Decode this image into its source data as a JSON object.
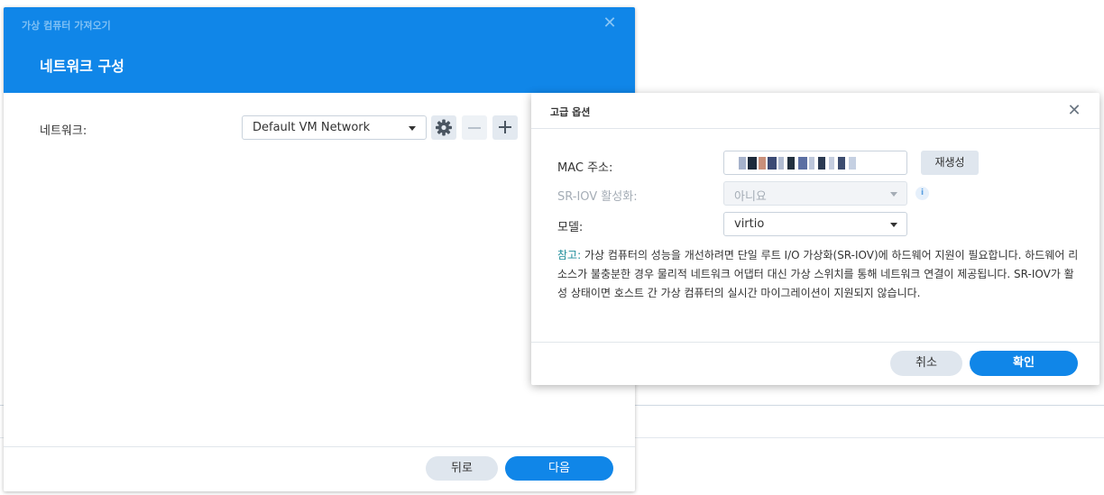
{
  "wizard": {
    "title": "가상 컴퓨터 가져오기",
    "step_title": "네트워크 구성",
    "network_label": "네트워크:",
    "network_value": "Default VM Network",
    "back_label": "뒤로",
    "next_label": "다음",
    "icons": {
      "close": "close-icon",
      "settings": "gear-icon",
      "remove": "minus-icon",
      "add": "plus-icon"
    }
  },
  "advanced": {
    "title": "고급 옵션",
    "mac_label": "MAC 주소:",
    "regenerate_label": "재생성",
    "sriov_label": "SR-IOV 활성화:",
    "sriov_value": "아니요",
    "model_label": "모델:",
    "model_value": "virtio",
    "note_prefix": "참고:",
    "note_text": " 가상 컴퓨터의 성능을 개선하려면 단일 루트 I/O 가상화(SR-IOV)에 하드웨어 지원이 필요합니다. 하드웨어 리소스가 불충분한 경우 물리적 네트워크 어댑터 대신 가상 스위치를 통해 네트워크 연결이 제공됩니다. SR-IOV가 활성 상태이면 호스트 간 가상 컴퓨터의 실시간 마이그레이션이 지원되지 않습니다.",
    "cancel_label": "취소",
    "ok_label": "확인",
    "icons": {
      "close": "close-icon",
      "info": "info-icon"
    }
  },
  "colors": {
    "accent": "#1086e8",
    "note_prefix": "#1c8c99"
  }
}
